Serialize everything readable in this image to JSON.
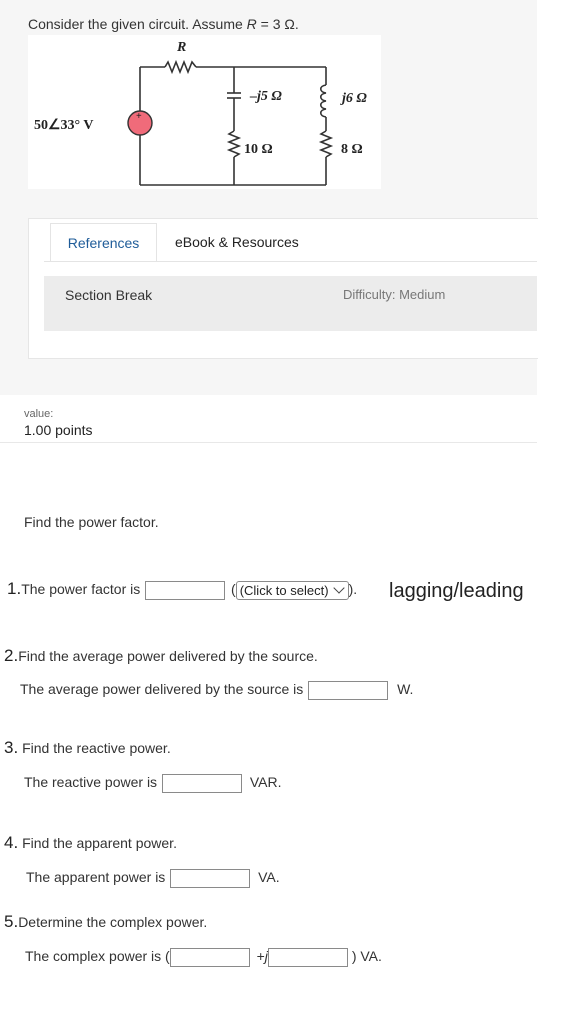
{
  "question": {
    "prefix": "Consider the given circuit. Assume ",
    "var": "R",
    "suffix": " = 3 Ω."
  },
  "circuit": {
    "label_R": "R",
    "label_source": "50∠33° V",
    "label_cap": "–j5 Ω",
    "label_res10": "10 Ω",
    "label_ind": "j6 Ω",
    "label_res8": "8 Ω",
    "source_sign": "+"
  },
  "tabs": {
    "references": "References",
    "ebook": "eBook & Resources"
  },
  "section": {
    "label": "Section Break",
    "difficulty": "Difficulty: Medium"
  },
  "value": {
    "label": "value:",
    "points": "1.00 points"
  },
  "find_pf": "Find the power factor.",
  "q1": {
    "num": "1.",
    "text": "The power factor is",
    "answer": "",
    "select_value": "(Click to select)",
    "paren_open": "(",
    "after": ").",
    "handnote": "lagging/leading"
  },
  "q2": {
    "num": "2.",
    "prompt": "Find the average power delivered by the source.",
    "text": "The average power delivered by the source is",
    "answer": "",
    "unit": "W."
  },
  "q3": {
    "num": "3.",
    "prompt": "Find the reactive power.",
    "text": "The reactive power is",
    "answer": "",
    "unit": "VAR."
  },
  "q4": {
    "num": "4.",
    "prompt": "Find the apparent power.",
    "text": "The apparent power is",
    "answer": "",
    "unit": "VA."
  },
  "q5": {
    "num": "5.",
    "prompt": "Determine the complex power.",
    "text": "The complex power is (",
    "answer_real": "",
    "plus": "+",
    "j": "j",
    "answer_imag": "",
    "unit": ") VA."
  }
}
